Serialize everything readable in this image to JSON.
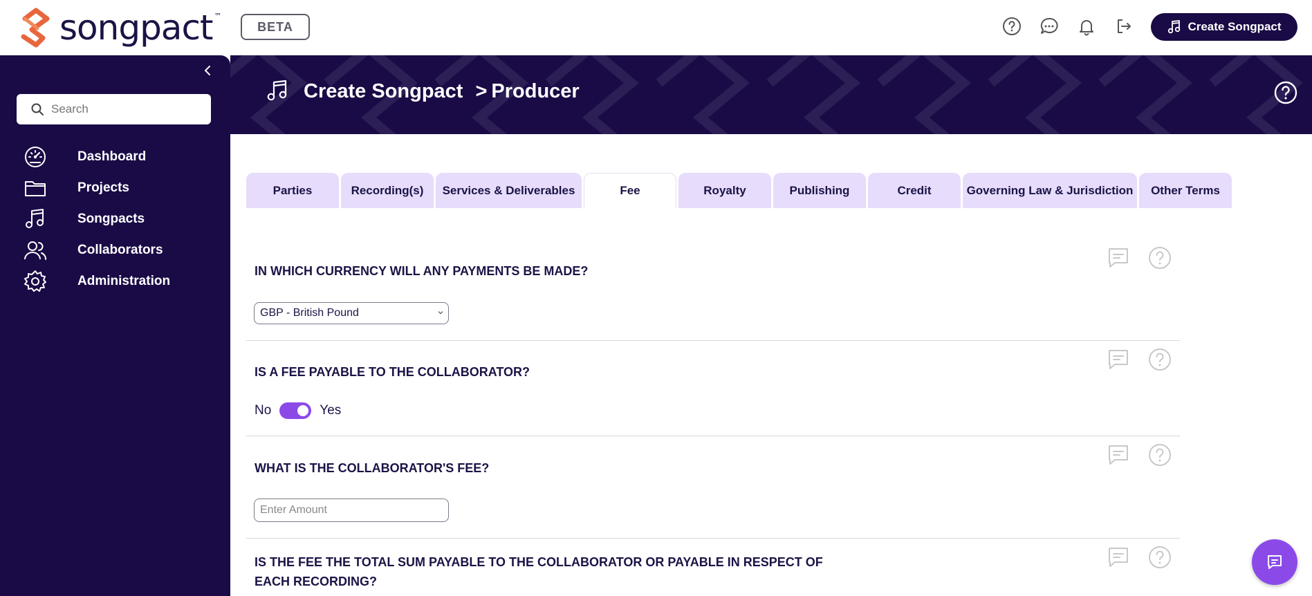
{
  "brand": {
    "name": "songpact",
    "tm": "™",
    "badge": "BETA",
    "accent": "#8b4ae8",
    "navy": "#1a0b46"
  },
  "topbar": {
    "icons": [
      "help-circle-icon",
      "chat-dots-icon",
      "bell-icon",
      "logout-icon"
    ],
    "create_button": "Create Songpact"
  },
  "sidebar": {
    "search_placeholder": "Search",
    "items": [
      {
        "label": "Dashboard",
        "icon": "dashboard-gauge-icon"
      },
      {
        "label": "Projects",
        "icon": "folder-icon"
      },
      {
        "label": "Songpacts",
        "icon": "music-note-icon"
      },
      {
        "label": "Collaborators",
        "icon": "users-icon"
      },
      {
        "label": "Administration",
        "icon": "gear-icon"
      }
    ]
  },
  "banner": {
    "title": "Create Songpact",
    "separator": ">",
    "subtitle": "Producer"
  },
  "tabs": [
    {
      "label": "Parties"
    },
    {
      "label": "Recording(s)"
    },
    {
      "label": "Services & Deliverables"
    },
    {
      "label": "Fee",
      "active": true
    },
    {
      "label": "Royalty"
    },
    {
      "label": "Publishing"
    },
    {
      "label": "Credit"
    },
    {
      "label": "Governing Law & Jurisdiction"
    },
    {
      "label": "Other Terms"
    }
  ],
  "questions": {
    "currency": {
      "question": "In which currency will any payments be made?",
      "selected": "GBP - British Pound"
    },
    "fee_payable": {
      "question": "Is a fee payable to the collaborator?",
      "off_label": "No",
      "on_label": "Yes",
      "value": true
    },
    "fee_amount": {
      "question": "What is the collaborator's fee?",
      "placeholder": "Enter Amount"
    },
    "fee_basis": {
      "question": "Is the fee the total sum payable to the collaborator or payable in respect of each recording?"
    }
  }
}
